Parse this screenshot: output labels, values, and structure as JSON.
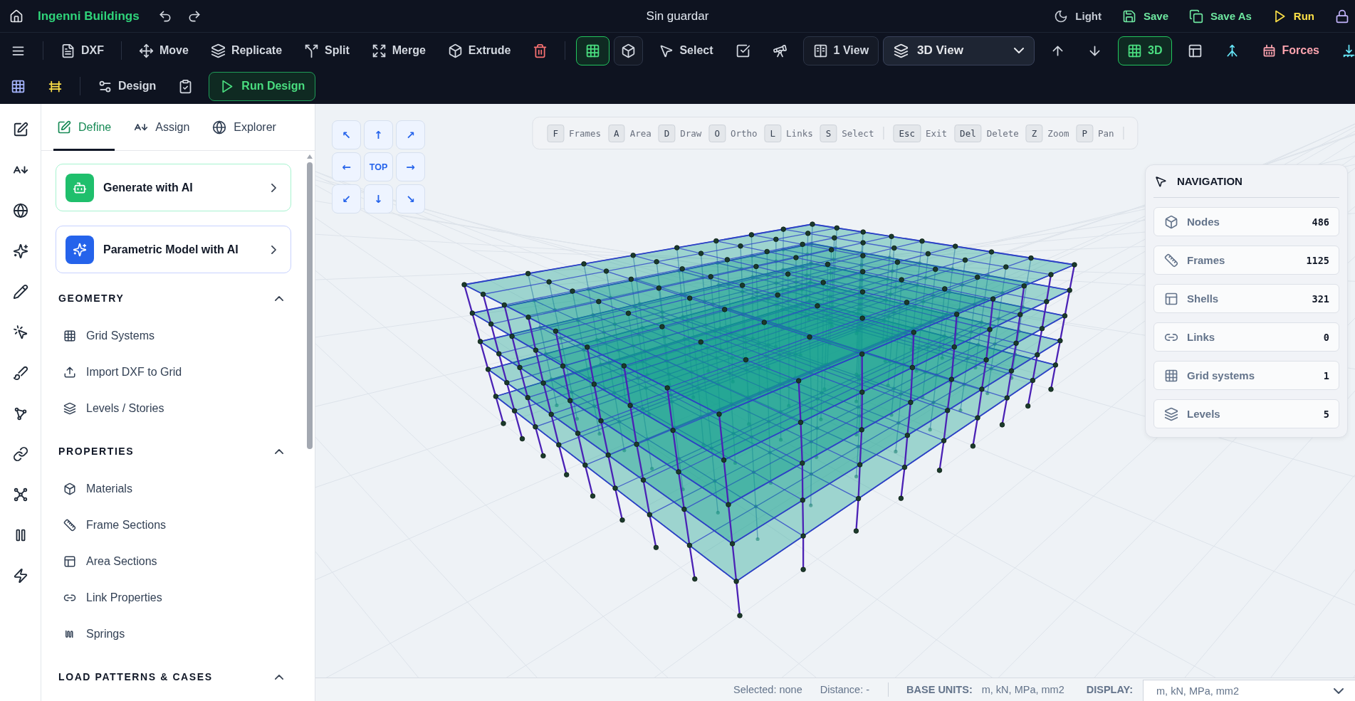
{
  "app_bar": {
    "title": "Ingenni Buildings",
    "file_status": "Sin guardar",
    "actions": [
      {
        "kind": "theme",
        "label": "Light"
      },
      {
        "kind": "save",
        "label": "Save"
      },
      {
        "kind": "save_as",
        "label": "Save As"
      },
      {
        "kind": "run",
        "label": "Run"
      },
      {
        "kind": "lock"
      }
    ]
  },
  "toolbar": {
    "groups": [
      [
        {
          "kind": "icon"
        }
      ],
      [
        {
          "kind": "tool",
          "label": "DXF"
        }
      ],
      [
        {
          "kind": "tool",
          "label": "Move"
        },
        {
          "kind": "tool",
          "label": "Replicate"
        },
        {
          "kind": "tool",
          "label": "Split"
        },
        {
          "kind": "tool",
          "label": "Merge"
        },
        {
          "kind": "tool",
          "label": "Extrude"
        },
        {
          "kind": "icon"
        }
      ],
      [
        {
          "kind": "toggle",
          "selected": true
        },
        {
          "kind": "toggle",
          "selected": false
        },
        {
          "kind": "tool",
          "label": "Select"
        },
        {
          "kind": "icon"
        },
        {
          "kind": "icon"
        },
        {
          "kind": "button",
          "label": "1 View"
        },
        {
          "kind": "dropdown",
          "label": "3D View"
        },
        {
          "kind": "icon"
        },
        {
          "kind": "icon"
        },
        {
          "kind": "toggle",
          "label": "3D",
          "selected": true
        },
        {
          "kind": "icon"
        },
        {
          "kind": "icon"
        },
        {
          "kind": "tool",
          "label": "Forces"
        },
        {
          "kind": "icon"
        }
      ]
    ]
  },
  "design_bar": {
    "groups": [
      [
        {
          "kind": "icon"
        },
        {
          "kind": "icon"
        }
      ],
      [
        {
          "kind": "tool",
          "label": "Design"
        },
        {
          "kind": "icon"
        },
        {
          "kind": "primary",
          "label": "Run Design"
        }
      ]
    ]
  },
  "panel": {
    "tabs": [
      {
        "label": "Define",
        "selected": true
      },
      {
        "label": "Assign",
        "selected": false
      },
      {
        "label": "Explorer",
        "selected": false
      }
    ],
    "ai_cards": [
      {
        "kind": "generate",
        "label": "Generate with AI"
      },
      {
        "kind": "parametric",
        "label": "Parametric Model with AI"
      }
    ],
    "sections": [
      {
        "title": "GEOMETRY",
        "expanded": true,
        "items": [
          "Grid Systems",
          "Import DXF to Grid",
          "Levels / Stories"
        ]
      },
      {
        "title": "PROPERTIES",
        "expanded": true,
        "items": [
          "Materials",
          "Frame Sections",
          "Area Sections",
          "Link Properties",
          "Springs"
        ]
      },
      {
        "title": "LOAD PATTERNS & CASES",
        "expanded": true
      }
    ]
  },
  "viewport": {
    "view_buttons": [
      "↖",
      "↑",
      "↗",
      "←",
      "TOP",
      "→",
      "↙",
      "↓",
      "↘"
    ],
    "shortcuts": [
      [
        {
          "key": "F",
          "label": "Frames"
        },
        {
          "key": "A",
          "label": "Area"
        },
        {
          "key": "D",
          "label": "Draw"
        },
        {
          "key": "O",
          "label": "Ortho"
        },
        {
          "key": "L",
          "label": "Links"
        },
        {
          "key": "S",
          "label": "Select"
        }
      ],
      [
        {
          "key": "Esc",
          "label": "Exit"
        },
        {
          "key": "Del",
          "label": "Delete"
        },
        {
          "key": "Z",
          "label": "Zoom"
        },
        {
          "key": "P",
          "label": "Pan"
        }
      ]
    ],
    "navigation": {
      "title": "NAVIGATION",
      "rows": [
        {
          "label": "Nodes",
          "value": "486"
        },
        {
          "label": "Frames",
          "value": "1125"
        },
        {
          "label": "Shells",
          "value": "321"
        },
        {
          "label": "Links",
          "value": "0"
        },
        {
          "label": "Grid systems",
          "value": "1"
        },
        {
          "label": "Levels",
          "value": "5"
        }
      ]
    }
  },
  "status_bar": {
    "selection": "Selected: none",
    "distance": "Distance: -",
    "base_units_label": "BASE UNITS:",
    "base_units": "m, kN, MPa, mm2",
    "display_label": "DISPLAY:",
    "display_units": "m, kN, MPa, mm2"
  }
}
